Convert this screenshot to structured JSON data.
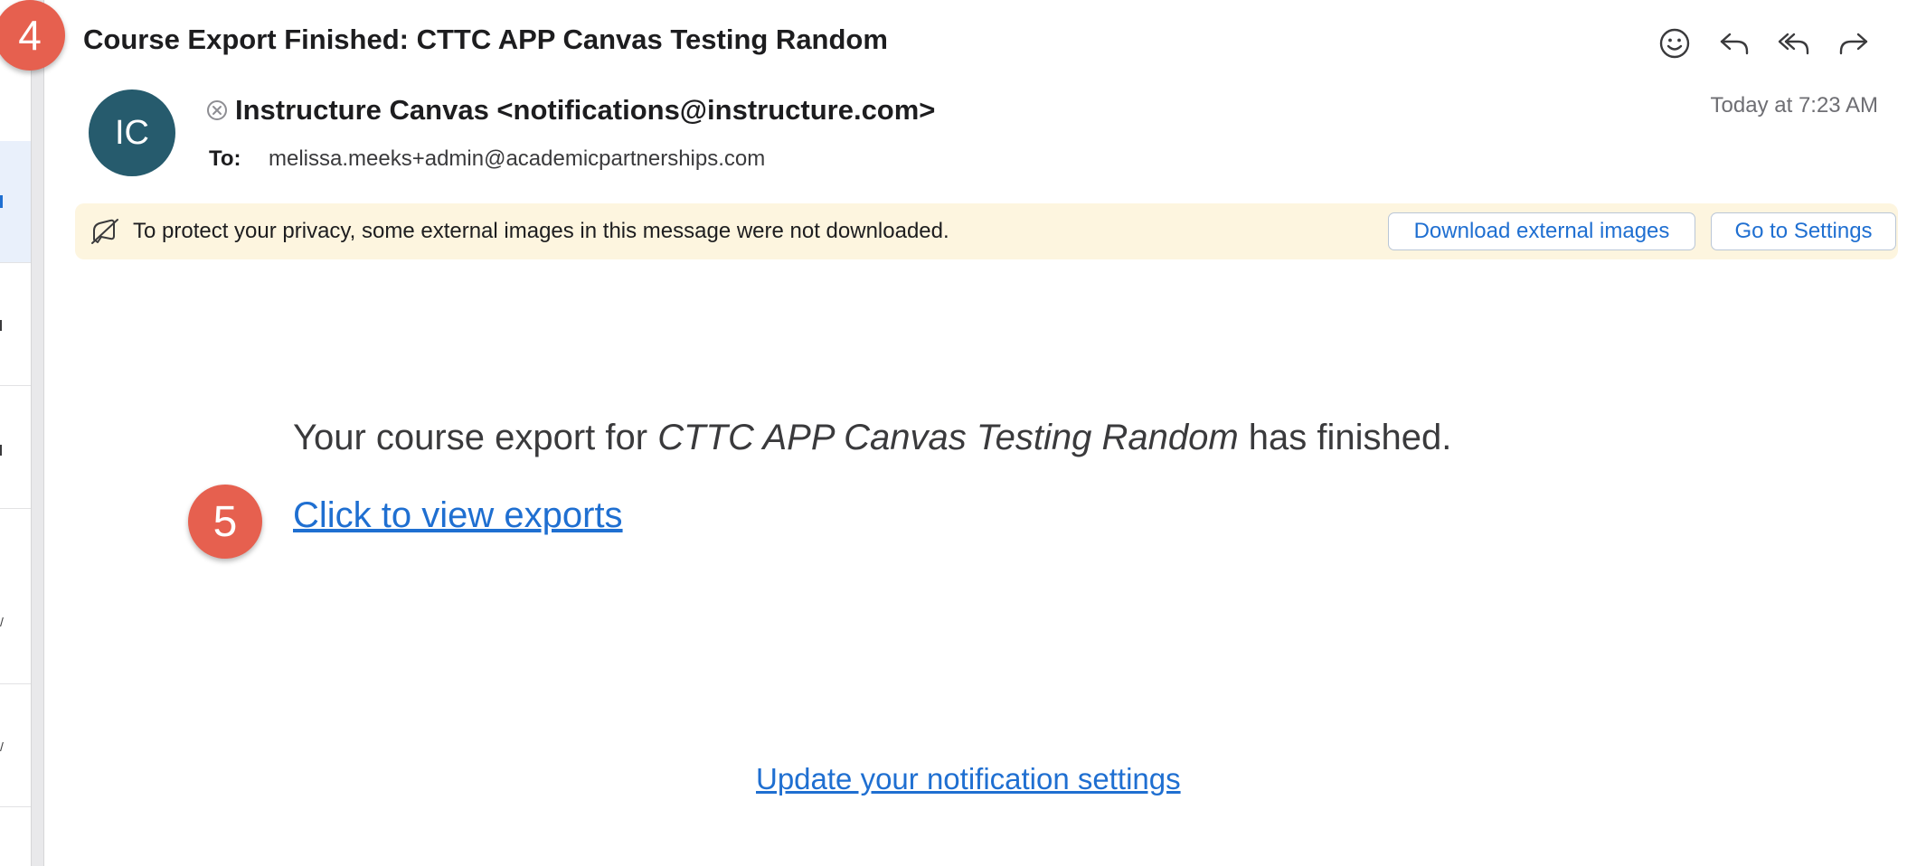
{
  "steps": {
    "header_step": "4",
    "link_step": "5"
  },
  "email": {
    "subject": "Course Export Finished: CTTC APP Canvas Testing Random",
    "sender_initials": "IC",
    "sender": "Instructure Canvas <notifications@instructure.com>",
    "timestamp": "Today at 7:23 AM",
    "to_label": "To:",
    "to_value": "melissa.meeks+admin@academicpartnerships.com"
  },
  "toolbar": {
    "icons": [
      "emoji-icon",
      "reply-icon",
      "reply-all-icon",
      "forward-icon"
    ]
  },
  "banner": {
    "text": "To protect your privacy, some external images in this message were not downloaded.",
    "download_label": "Download external images",
    "settings_label": "Go to Settings"
  },
  "body": {
    "line_prefix": "Your course export for ",
    "course_name": "CTTC APP Canvas Testing Random",
    "line_suffix": " has finished.",
    "exports_link": "Click to view exports",
    "settings_link": "Update your notification settings"
  },
  "colors": {
    "badge": "#e6604f",
    "avatar": "#265b6d",
    "link": "#1f6fd1",
    "banner_bg": "#fdf5df"
  }
}
